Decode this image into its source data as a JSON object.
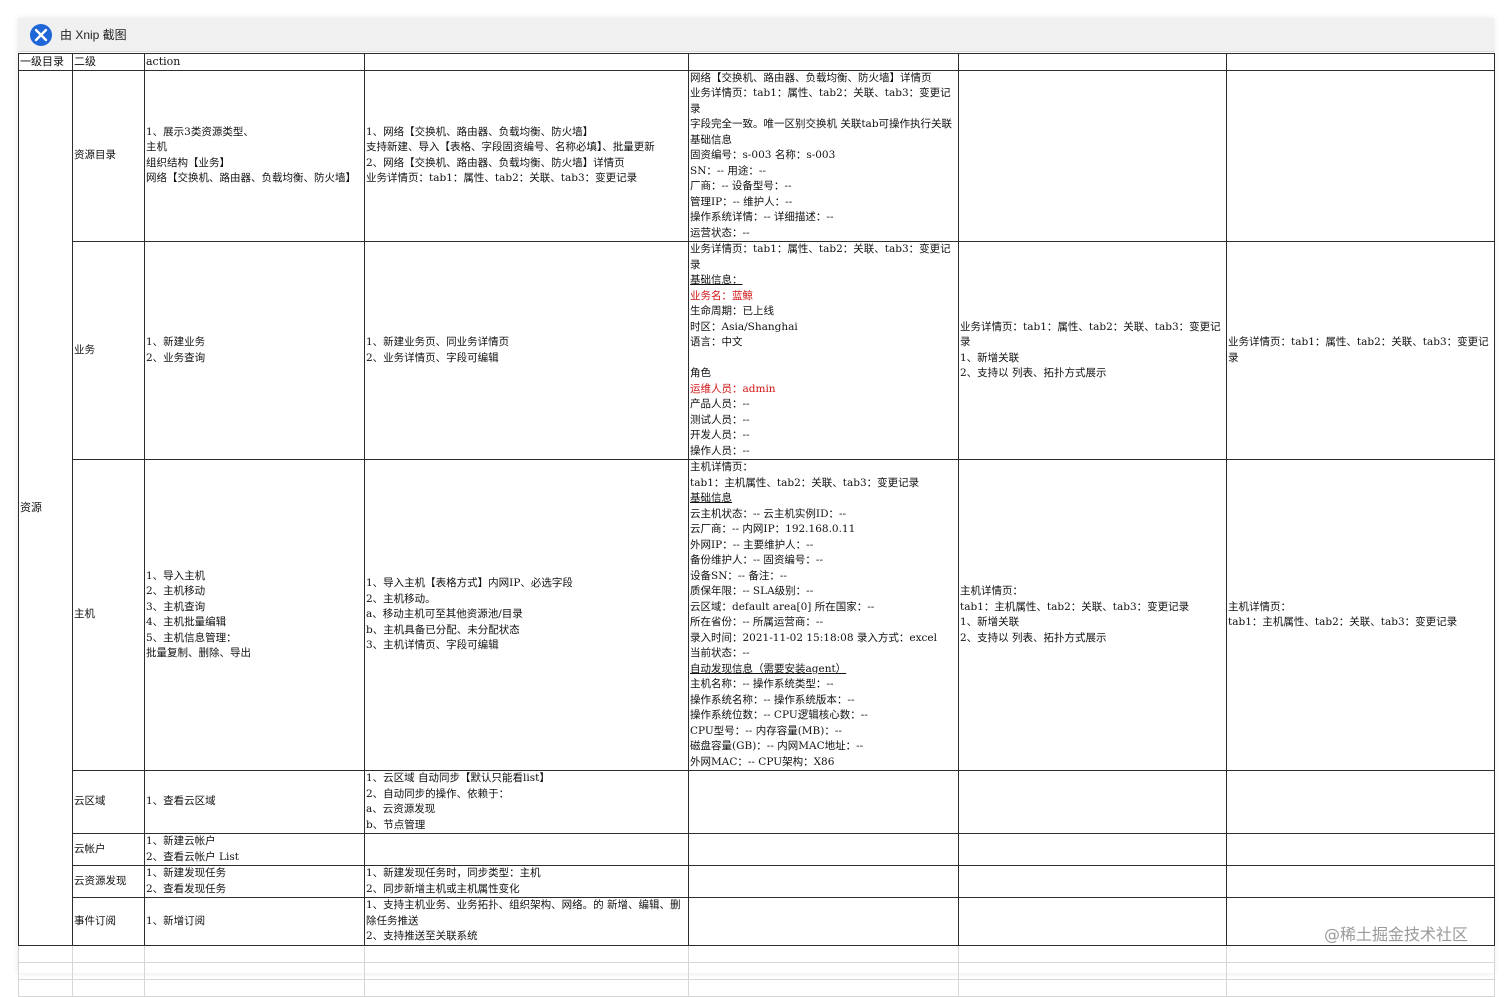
{
  "window": {
    "title": "由 Xnip 截图"
  },
  "header": {
    "col1": "一级目录",
    "col2": "二级",
    "col3": "action",
    "col4": "",
    "col5": "",
    "col6": "",
    "col7": ""
  },
  "level1": "资源",
  "rows": [
    {
      "name": "资源目录",
      "action": "1、展示3类资源类型、\n主机\n组织结构【业务】\n网络【交换机、路由器、负载均衡、防火墙】",
      "col4": "1、网络【交换机、路由器、负载均衡、防火墙】\n支持新建、导入【表格、字段固资编号、名称必填】、批量更新\n2、网络【交换机、路由器、负载均衡、防火墙】详情页\n业务详情页：tab1：属性、tab2：关联、tab3：变更记录",
      "col5": "网络【交换机、路由器、负载均衡、防火墙】详情页\n业务详情页：tab1：属性、tab2：关联、tab3：变更记录\n字段完全一致。唯一区别交换机 关联tab可操作执行关联\n基础信息\n固资编号：s-003 名称：s-003\nSN：-- 用途：--\n厂商：-- 设备型号：--\n管理IP：-- 维护人：--\n操作系统详情：-- 详细描述：--\n运营状态：--",
      "col6": "",
      "col7": ""
    },
    {
      "name": "业务",
      "action": "1、新建业务\n2、业务查询",
      "col4": "1、新建业务页、同业务详情页\n2、业务详情页、字段可编辑",
      "col5_lines": [
        "业务详情页：tab1：属性、tab2：关联、tab3：变更记录",
        "基础信息：",
        "业务名：蓝鲸",
        "生命周期：已上线",
        "时区：Asia/Shanghai",
        "语言：中文",
        "",
        "角色",
        "运维人员：admin",
        "产品人员：--",
        "测试人员：--",
        "开发人员：--",
        "操作人员：--"
      ],
      "col6": "业务详情页：tab1：属性、tab2：关联、tab3：变更记录\n1、新增关联\n2、支持以 列表、拓扑方式展示",
      "col7": "业务详情页：tab1：属性、tab2：关联、tab3：变更记录"
    },
    {
      "name": "主机",
      "action": "1、导入主机\n2、主机移动\n3、主机查询\n4、主机批量编辑\n5、主机信息管理：\n批量复制、删除、导出",
      "col4": "1、导入主机【表格方式】内网IP、必选字段\n2、主机移动。\na、移动主机可至其他资源池/目录\nb、主机具备已分配、未分配状态\n3、主机详情页、字段可编辑",
      "col5_lines": [
        "主机详情页：",
        "tab1：主机属性、tab2：关联、tab3：变更记录",
        "基础信息",
        "云主机状态：-- 云主机实例ID：--",
        "云厂商：-- 内网IP：192.168.0.11",
        "外网IP：-- 主要维护人：--",
        "备份维护人：-- 固资编号：--",
        "设备SN：-- 备注：--",
        "质保年限：-- SLA级别：--",
        "云区域：default area[0] 所在国家：--",
        "所在省份：-- 所属运营商：--",
        "录入时间：2021-11-02 15:18:08 录入方式：excel",
        "当前状态：--",
        "自动发现信息（需要安装agent）",
        "主机名称：-- 操作系统类型：--",
        "操作系统名称：-- 操作系统版本：--",
        "操作系统位数：-- CPU逻辑核心数：--",
        "CPU型号：-- 内存容量(MB)：--",
        "磁盘容量(GB)：-- 内网MAC地址：--",
        "外网MAC：-- CPU架构：X86"
      ],
      "col6": "主机详情页：\ntab1：主机属性、tab2：关联、tab3：变更记录\n1、新增关联\n2、支持以 列表、拓扑方式展示",
      "col7": "主机详情页：\ntab1：主机属性、tab2：关联、tab3：变更记录"
    },
    {
      "name": "云区域",
      "action": "1、查看云区域",
      "col4": "1、云区域 自动同步【默认只能看list】\n2、自动同步的操作、依赖于：\na、云资源发现\nb、节点管理",
      "col5": "",
      "col6": "",
      "col7": ""
    },
    {
      "name": "云帐户",
      "action": "1、新建云帐户\n2、查看云帐户 List",
      "col4": "",
      "col5": "",
      "col6": "",
      "col7": ""
    },
    {
      "name": "云资源发现",
      "action": "1、新建发现任务\n2、查看发现任务",
      "col4": "1、新建发现任务时，同步类型：主机\n2、同步新增主机或主机属性变化",
      "col5": "",
      "col6": "",
      "col7": ""
    },
    {
      "name": "事件订阅",
      "action": "1、新增订阅",
      "col4": "1、支持主机业务、业务拓扑、组织架构、网络。的 新增、编辑、删除任务推送\n2、支持推送至关联系统",
      "col5": "",
      "col6": "",
      "col7": ""
    }
  ],
  "watermark": "@稀土掘金技术社区",
  "colors": {
    "red_text": "#d21414",
    "icon_blue": "#1f67d8"
  }
}
